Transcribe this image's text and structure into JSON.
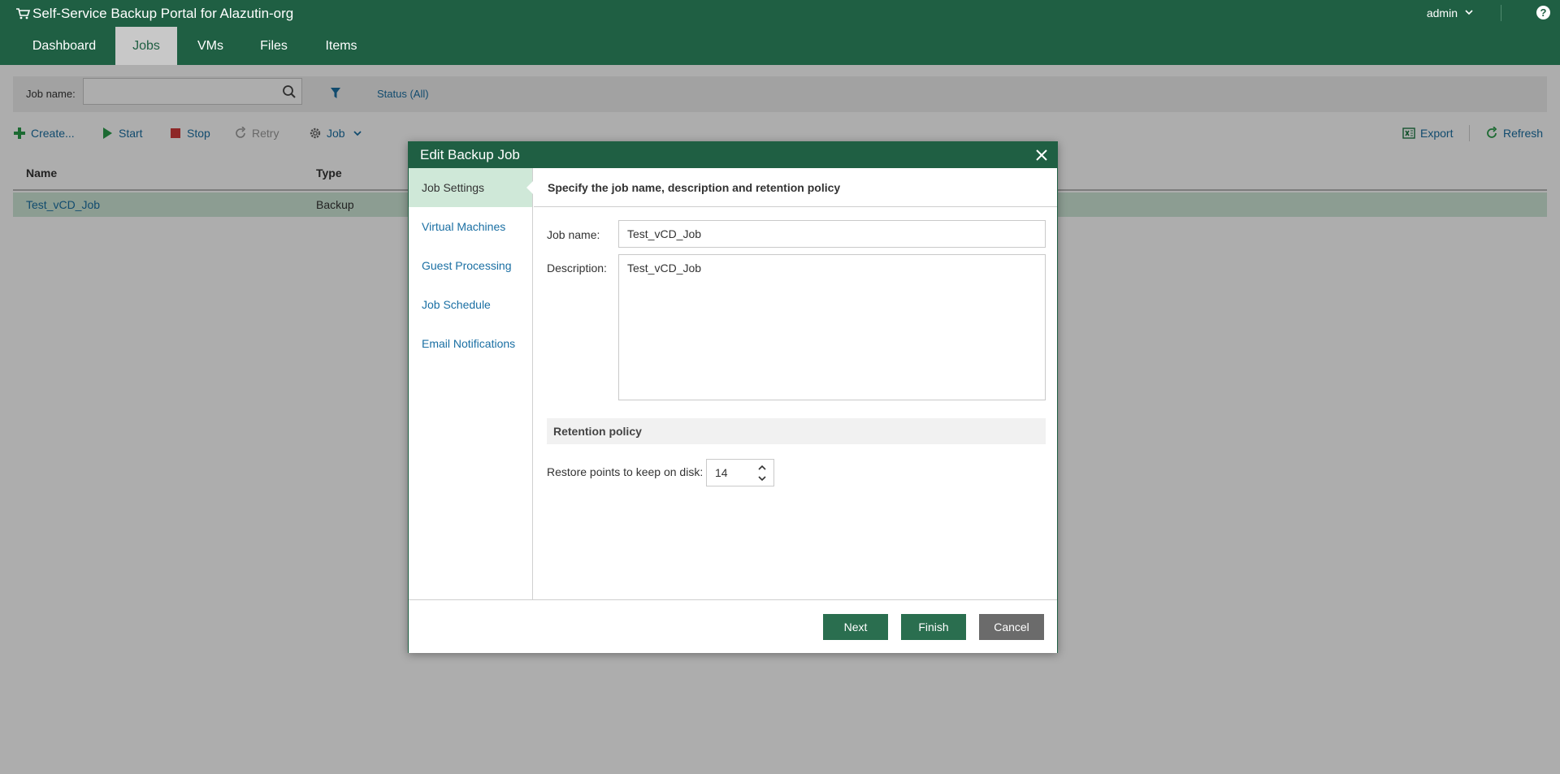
{
  "header": {
    "title": "Self-Service Backup Portal for Alazutin-org",
    "user": "admin",
    "help": "?"
  },
  "nav": {
    "tabs": [
      {
        "label": "Dashboard"
      },
      {
        "label": "Jobs"
      },
      {
        "label": "VMs"
      },
      {
        "label": "Files"
      },
      {
        "label": "Items"
      }
    ],
    "active": "Jobs"
  },
  "filter": {
    "job_name_label": "Job name:",
    "job_name_value": "",
    "status_label": "Status (All)"
  },
  "toolbar": {
    "create": "Create...",
    "start": "Start",
    "stop": "Stop",
    "retry": "Retry",
    "job": "Job",
    "export": "Export",
    "refresh": "Refresh"
  },
  "grid": {
    "columns": [
      "Name",
      "Type"
    ],
    "rows": [
      {
        "name": "Test_vCD_Job",
        "type": "Backup"
      }
    ]
  },
  "dialog": {
    "title": "Edit Backup Job",
    "steps": [
      {
        "label": "Job Settings"
      },
      {
        "label": "Virtual Machines"
      },
      {
        "label": "Guest Processing"
      },
      {
        "label": "Job Schedule"
      },
      {
        "label": "Email Notifications"
      }
    ],
    "active_step": "Job Settings",
    "panel_title": "Specify the job name, description and retention policy",
    "job_name_label": "Job name:",
    "job_name_value": "Test_vCD_Job",
    "description_label": "Description:",
    "description_value": "Test_vCD_Job",
    "retention_title": "Retention policy",
    "restore_points_label": "Restore points to keep on disk:",
    "restore_points_value": "14",
    "buttons": {
      "next": "Next",
      "finish": "Finish",
      "cancel": "Cancel"
    }
  },
  "colors": {
    "brand": "#1f5f43",
    "link": "#1a6fa3",
    "selected_row": "#cfe8d8",
    "stop_red": "#d13b3b",
    "start_green": "#2a9d4b"
  }
}
